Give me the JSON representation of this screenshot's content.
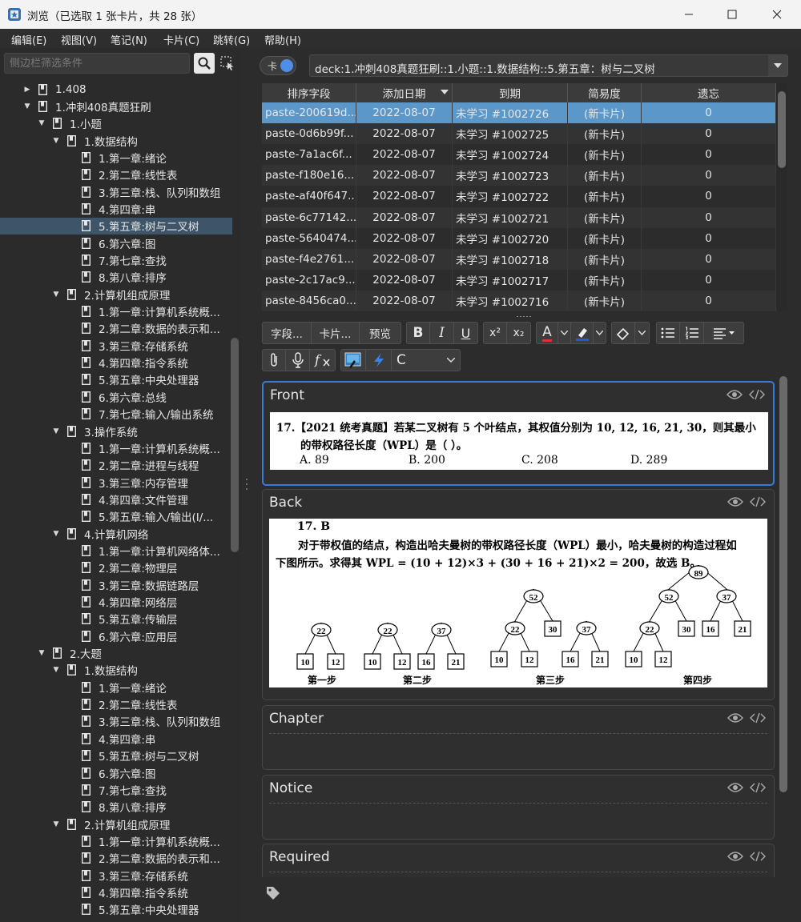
{
  "window": {
    "title": "浏览（已选取 1 张卡片，共 28 张）"
  },
  "menu": [
    "编辑(E)",
    "视图(V)",
    "笔记(N)",
    "卡片(C)",
    "跳转(G)",
    "帮助(H)"
  ],
  "sidebar": {
    "filter_placeholder": "侧边栏筛选条件",
    "tree": [
      {
        "label": "1.408",
        "level": 1,
        "arrow": "right"
      },
      {
        "label": "1.冲刺408真题狂刷",
        "level": 1,
        "arrow": "down"
      },
      {
        "label": "1.小题",
        "level": 2,
        "arrow": "down"
      },
      {
        "label": "1.数据结构",
        "level": 3,
        "arrow": "down"
      },
      {
        "label": "1.第一章:绪论",
        "level": 4
      },
      {
        "label": "2.第二章:线性表",
        "level": 4
      },
      {
        "label": "3.第三章:栈、队列和数组",
        "level": 4
      },
      {
        "label": "4.第四章:串",
        "level": 4
      },
      {
        "label": "5.第五章:树与二叉树",
        "level": 4,
        "selected": true
      },
      {
        "label": "6.第六章:图",
        "level": 4
      },
      {
        "label": "7.第七章:查找",
        "level": 4
      },
      {
        "label": "8.第八章:排序",
        "level": 4
      },
      {
        "label": "2.计算机组成原理",
        "level": 3,
        "arrow": "down"
      },
      {
        "label": "1.第一章:计算机系统概...",
        "level": 4
      },
      {
        "label": "2.第二章:数据的表示和...",
        "level": 4
      },
      {
        "label": "3.第三章:存储系统",
        "level": 4
      },
      {
        "label": "4.第四章:指令系统",
        "level": 4
      },
      {
        "label": "5.第五章:中央处理器",
        "level": 4
      },
      {
        "label": "6.第六章:总线",
        "level": 4
      },
      {
        "label": "7.第七章:输入/输出系统",
        "level": 4
      },
      {
        "label": "3.操作系统",
        "level": 3,
        "arrow": "down"
      },
      {
        "label": "1.第一章:计算机系统概...",
        "level": 4
      },
      {
        "label": "2.第二章:进程与线程",
        "level": 4
      },
      {
        "label": "3.第三章:内存管理",
        "level": 4
      },
      {
        "label": "4.第四章:文件管理",
        "level": 4
      },
      {
        "label": "5.第五章:输入/输出(I/...",
        "level": 4
      },
      {
        "label": "4.计算机网络",
        "level": 3,
        "arrow": "down"
      },
      {
        "label": "1.第一章:计算机网络体...",
        "level": 4
      },
      {
        "label": "2.第二章:物理层",
        "level": 4
      },
      {
        "label": "3.第三章:数据链路层",
        "level": 4
      },
      {
        "label": "4.第四章:网络层",
        "level": 4
      },
      {
        "label": "5.第五章:传输层",
        "level": 4
      },
      {
        "label": "6.第六章:应用层",
        "level": 4
      },
      {
        "label": "2.大题",
        "level": 2,
        "arrow": "down"
      },
      {
        "label": "1.数据结构",
        "level": 3,
        "arrow": "down"
      },
      {
        "label": "1.第一章:绪论",
        "level": 4
      },
      {
        "label": "2.第二章:线性表",
        "level": 4
      },
      {
        "label": "3.第三章:栈、队列和数组",
        "level": 4
      },
      {
        "label": "4.第四章:串",
        "level": 4
      },
      {
        "label": "5.第五章:树与二叉树",
        "level": 4
      },
      {
        "label": "6.第六章:图",
        "level": 4
      },
      {
        "label": "7.第七章:查找",
        "level": 4
      },
      {
        "label": "8.第八章:排序",
        "level": 4
      },
      {
        "label": "2.计算机组成原理",
        "level": 3,
        "arrow": "down"
      },
      {
        "label": "1.第一章:计算机系统概...",
        "level": 4
      },
      {
        "label": "2.第二章:数据的表示和...",
        "level": 4
      },
      {
        "label": "3.第三章:存储系统",
        "level": 4
      },
      {
        "label": "4.第四章:指令系统",
        "level": 4
      },
      {
        "label": "5.第五章:中央处理器",
        "level": 4
      }
    ]
  },
  "search": {
    "toggle_label": "卡",
    "query": "deck:1.冲刺408真题狂刷::1.小题::1.数据结构::5.第五章：树与二叉树"
  },
  "table": {
    "columns": [
      "排序字段",
      "添加日期",
      "到期",
      "简易度",
      "遗忘"
    ],
    "rows": [
      [
        "paste-200619d...",
        "2022-08-07",
        "未学习 #1002726",
        "(新卡片)",
        "0"
      ],
      [
        "paste-0d6b99f...",
        "2022-08-07",
        "未学习 #1002725",
        "(新卡片)",
        "0"
      ],
      [
        "paste-7a1ac6f...",
        "2022-08-07",
        "未学习 #1002724",
        "(新卡片)",
        "0"
      ],
      [
        "paste-f180e16...",
        "2022-08-07",
        "未学习 #1002723",
        "(新卡片)",
        "0"
      ],
      [
        "paste-af40f647...",
        "2022-08-07",
        "未学习 #1002722",
        "(新卡片)",
        "0"
      ],
      [
        "paste-6c77142...",
        "2022-08-07",
        "未学习 #1002721",
        "(新卡片)",
        "0"
      ],
      [
        "paste-5640474...",
        "2022-08-07",
        "未学习 #1002720",
        "(新卡片)",
        "0"
      ],
      [
        "paste-f4e2761...",
        "2022-08-07",
        "未学习 #1002718",
        "(新卡片)",
        "0"
      ],
      [
        "paste-2c17ac9...",
        "2022-08-07",
        "未学习 #1002717",
        "(新卡片)",
        "0"
      ],
      [
        "paste-8456ca0...",
        "2022-08-07",
        "未学习 #1002716",
        "(新卡片)",
        "0"
      ]
    ],
    "selected_row": 0
  },
  "toolbar": {
    "fields_btn": "字段...",
    "cards_btn": "卡片...",
    "preview_btn": "预览",
    "bold": "B",
    "italic": "I",
    "underline": "U",
    "superscript": "x²",
    "subscript": "x₂",
    "font_color_letter": "A",
    "font_select": "C",
    "colors": {
      "font": "#e03030",
      "highlight": "#2a57d8",
      "focus": "#3b7ad8"
    }
  },
  "fields": {
    "front": {
      "label": "Front",
      "q_line1": "17.【2021 统考真题】若某二叉树有 5 个叶结点，其权值分别为 10, 12, 16, 21, 30，则其最小",
      "q_line2": "的带权路径长度（WPL）是（    ）。",
      "options": [
        "A.  89",
        "B.  200",
        "C.  208",
        "D.  289"
      ]
    },
    "back": {
      "label": "Back",
      "answer": "17.  B",
      "line1": "对于带权值的结点，构造出哈夫曼树的带权路径长度（WPL）最小，哈夫曼树的构造过程如",
      "line2": "下图所示。求得其 WPL = (10 + 12)×3 + (30 + 16 + 21)×2 = 200，故选 B。",
      "steps": [
        "第一步",
        "第二步",
        "第三步",
        "第四步"
      ],
      "nodes": [
        "22",
        "10",
        "12",
        "22",
        "10",
        "12",
        "37",
        "16",
        "21",
        "52",
        "22",
        "10",
        "12",
        "30",
        "37",
        "16",
        "21",
        "89",
        "52",
        "22",
        "10",
        "12",
        "30",
        "37",
        "16",
        "21"
      ]
    },
    "chapter": {
      "label": "Chapter"
    },
    "notice": {
      "label": "Notice"
    },
    "required": {
      "label": "Required"
    }
  }
}
